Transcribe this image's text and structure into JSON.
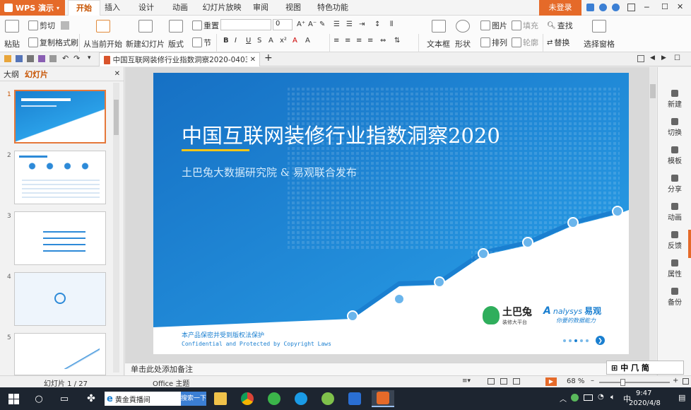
{
  "app": {
    "name": "WPS 演示"
  },
  "tabs": [
    "开始",
    "插入",
    "设计",
    "动画",
    "幻灯片放映",
    "审阅",
    "视图",
    "特色功能"
  ],
  "login": "未登录",
  "ribbon": {
    "paste": "粘贴",
    "cut": "剪切",
    "copy": "复制",
    "format_painter": "格式刷",
    "from_current": "从当前开始",
    "new_slide": "新建幻灯片",
    "layout": "版式",
    "reset": "重置",
    "section": "节",
    "font_size": "0",
    "textbox": "文本框",
    "shape": "形状",
    "picture": "图片",
    "fill": "填充",
    "arrange": "排列",
    "outline": "轮廓",
    "find": "查找",
    "replace": "替换",
    "select_pane": "选择窗格"
  },
  "document": {
    "filename": "中国互联网装修行业指数洞察2020-0403.pptx"
  },
  "leftpanel": {
    "outline": "大纲",
    "slides": "幻灯片",
    "numbers": [
      "1",
      "2",
      "3",
      "4",
      "5"
    ]
  },
  "slide": {
    "title": "中国互联网装修行业指数洞察2020",
    "subtitle": "土巴兔大数据研究院 & 易观联合发布",
    "copyright_cn": "本产品保密并受到版权法保护",
    "copyright_en": "Confidential and Protected by Copyright Laws",
    "logo1_name": "土巴兔",
    "logo1_sub": "装修大平台",
    "logo2_name": "易观",
    "logo2_en": "nalysys",
    "logo2_sub": "你要的数据能力"
  },
  "rightbar": [
    "新建",
    "切换",
    "模板",
    "分享",
    "动画",
    "反馈",
    "属性",
    "备份"
  ],
  "notes": "单击此处添加备注",
  "status": {
    "slide_count": "幻灯片 1 / 27",
    "theme": "Office 主题",
    "zoom": "68 %"
  },
  "ime": "中 ⺇ 简",
  "taskbar": {
    "search_value": "黄金貢播间",
    "search_btn": "搜索一下",
    "time": "9:47",
    "date": "2020/4/8"
  },
  "colors": {
    "accent": "#e56a29",
    "slide_blue": "#1b8ad8",
    "taskbar": "#1d2530"
  }
}
